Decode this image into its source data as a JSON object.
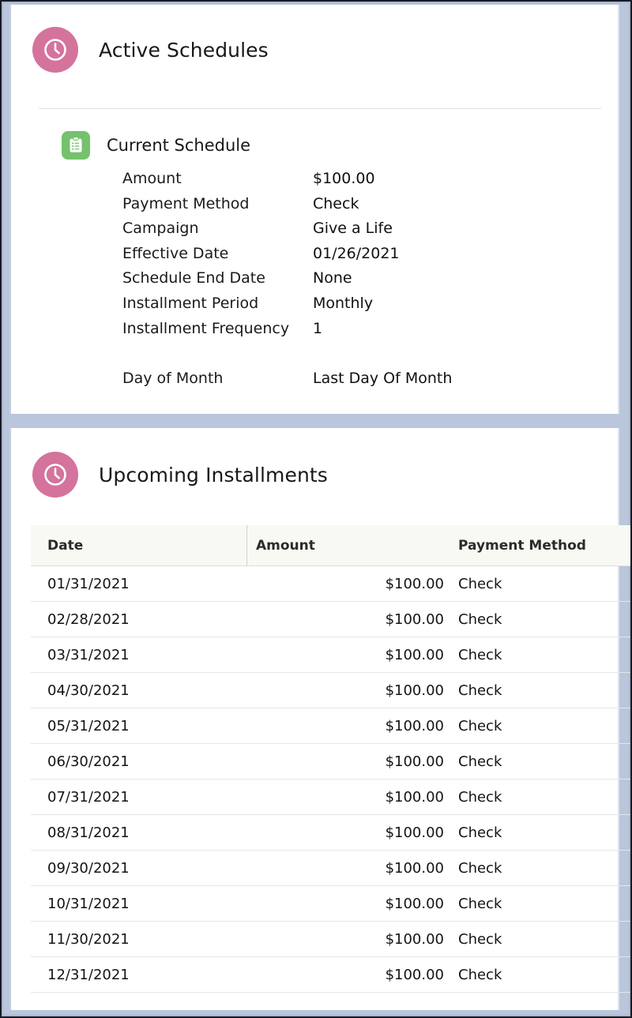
{
  "window": {
    "frame_border_color": "#1a1a24",
    "gap_color": "#b9c6dc"
  },
  "colors": {
    "accent_pink": "#d4739c",
    "accent_green": "#74c26c",
    "table_header_bg": "#f9f9f3",
    "row_border": "#e6e6e6"
  },
  "active_schedules": {
    "title": "Active Schedules",
    "icon": "clock-icon",
    "current_schedule": {
      "title": "Current Schedule",
      "icon": "clipboard-list-icon",
      "fields": [
        {
          "label": "Amount",
          "value": "$100.00"
        },
        {
          "label": "Payment Method",
          "value": "Check"
        },
        {
          "label": "Campaign",
          "value": "Give a Life"
        },
        {
          "label": "Effective Date",
          "value": "01/26/2021"
        },
        {
          "label": "Schedule End Date",
          "value": "None"
        },
        {
          "label": "Installment Period",
          "value": "Monthly"
        },
        {
          "label": "Installment Frequency",
          "value": "1"
        },
        {
          "label": "Day of Month",
          "value": "Last Day Of Month"
        }
      ]
    }
  },
  "upcoming_installments": {
    "title": "Upcoming Installments",
    "icon": "clock-icon",
    "table": {
      "columns": [
        "Date",
        "Amount",
        "Payment Method"
      ],
      "rows": [
        {
          "date": "01/31/2021",
          "amount": "$100.00",
          "method": "Check"
        },
        {
          "date": "02/28/2021",
          "amount": "$100.00",
          "method": "Check"
        },
        {
          "date": "03/31/2021",
          "amount": "$100.00",
          "method": "Check"
        },
        {
          "date": "04/30/2021",
          "amount": "$100.00",
          "method": "Check"
        },
        {
          "date": "05/31/2021",
          "amount": "$100.00",
          "method": "Check"
        },
        {
          "date": "06/30/2021",
          "amount": "$100.00",
          "method": "Check"
        },
        {
          "date": "07/31/2021",
          "amount": "$100.00",
          "method": "Check"
        },
        {
          "date": "08/31/2021",
          "amount": "$100.00",
          "method": "Check"
        },
        {
          "date": "09/30/2021",
          "amount": "$100.00",
          "method": "Check"
        },
        {
          "date": "10/31/2021",
          "amount": "$100.00",
          "method": "Check"
        },
        {
          "date": "11/30/2021",
          "amount": "$100.00",
          "method": "Check"
        },
        {
          "date": "12/31/2021",
          "amount": "$100.00",
          "method": "Check"
        }
      ]
    }
  }
}
